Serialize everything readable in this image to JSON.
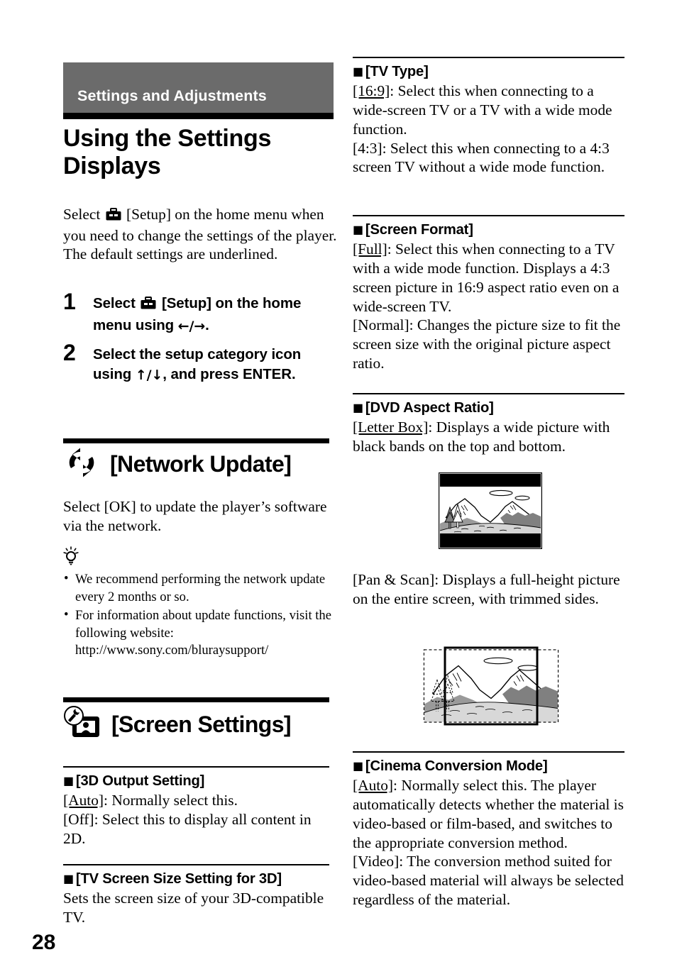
{
  "document": {
    "page_number": "28",
    "chapter_banner": "Settings and Adjustments",
    "page_title": "Using the Settings Displays"
  },
  "colors": {
    "banner_background": "#6b6b6b",
    "banner_text": "#ffffff",
    "rule": "#000000",
    "illustration_dark_gray": "#808080",
    "illustration_light_gray": "#b3b3b3"
  },
  "intro": {
    "line1_before_icon": "Select ",
    "setup_icon": "toolbox-icon",
    "line1_after_icon": " [Setup] on the home menu when you need to change the settings of the player.",
    "line2": "The default settings are underlined."
  },
  "steps": [
    {
      "number": "1",
      "text_before_icon": "Select ",
      "icon": "toolbox-icon",
      "text_after_icon": " [Setup] on the home menu using ",
      "arrows": "←/→",
      "text_end": "."
    },
    {
      "number": "2",
      "text_before_icon": "Select the setup category icon using ",
      "icon": "",
      "text_after_icon": "",
      "arrows": "↑/↓",
      "text_end": ", and press ENTER."
    }
  ],
  "sections": {
    "network_update": {
      "icon": "network-update-icon",
      "title": "[Network Update]",
      "body": "Select [OK] to update the player’s software via the network.",
      "tip_icon": "tip-bulb-icon",
      "tips": [
        "We recommend performing the network update every 2 months or so.",
        "For information about update functions, visit the following website: http://www.sony.com/bluraysupport/"
      ]
    },
    "screen_settings": {
      "icon": "screen-settings-icon",
      "title": "[Screen Settings]"
    }
  },
  "subsections": {
    "output_3d": {
      "title": "[3D Output Setting]",
      "options": [
        {
          "label": "[Auto]",
          "underlined": true,
          "text": ": Normally select this."
        },
        {
          "label": "[Off]",
          "underlined": false,
          "text": ": Select this to display all content in 2D."
        }
      ]
    },
    "tv_screen_size_3d": {
      "title": "[TV Screen Size Setting for 3D]",
      "body": "Sets the screen size of your 3D-compatible TV."
    },
    "tv_type": {
      "title": "[TV Type]",
      "options": [
        {
          "label": "[16:9]",
          "underlined": true,
          "text": ": Select this when connecting to a wide-screen TV or a TV with a wide mode function."
        },
        {
          "label": "[4:3]",
          "underlined": false,
          "text": ": Select this when connecting to a 4:3 screen TV without a wide mode function."
        }
      ]
    },
    "screen_format": {
      "title": "[Screen Format]",
      "options": [
        {
          "label": "[Full]",
          "underlined": true,
          "text": ": Select this when connecting to a TV with a wide mode function. Displays a 4:3 screen picture in 16:9 aspect ratio even on a wide-screen TV."
        },
        {
          "label": "[Normal]",
          "underlined": false,
          "text": ": Changes the picture size to fit the screen size with the original picture aspect ratio."
        }
      ]
    },
    "dvd_aspect_ratio": {
      "title": "[DVD Aspect Ratio]",
      "options": [
        {
          "label": "[Letter Box]",
          "underlined": true,
          "text": ": Displays a wide picture with black bands on the top and bottom."
        },
        {
          "label": "[Pan & Scan]",
          "underlined": false,
          "text": ": Displays a full-height picture on the entire screen, with trimmed sides."
        }
      ],
      "figure_letterbox": "letterbox-illustration",
      "figure_panscan": "pan-and-scan-illustration"
    },
    "cinema_conversion_mode": {
      "title": "[Cinema Conversion Mode]",
      "options": [
        {
          "label": "[Auto]",
          "underlined": true,
          "text": ": Normally select this. The player automatically detects whether the material is video-based or film-based, and switches to the appropriate conversion method."
        },
        {
          "label": "[Video]",
          "underlined": false,
          "text": ": The conversion method suited for video-based material will always be selected regardless of the material."
        }
      ]
    }
  }
}
